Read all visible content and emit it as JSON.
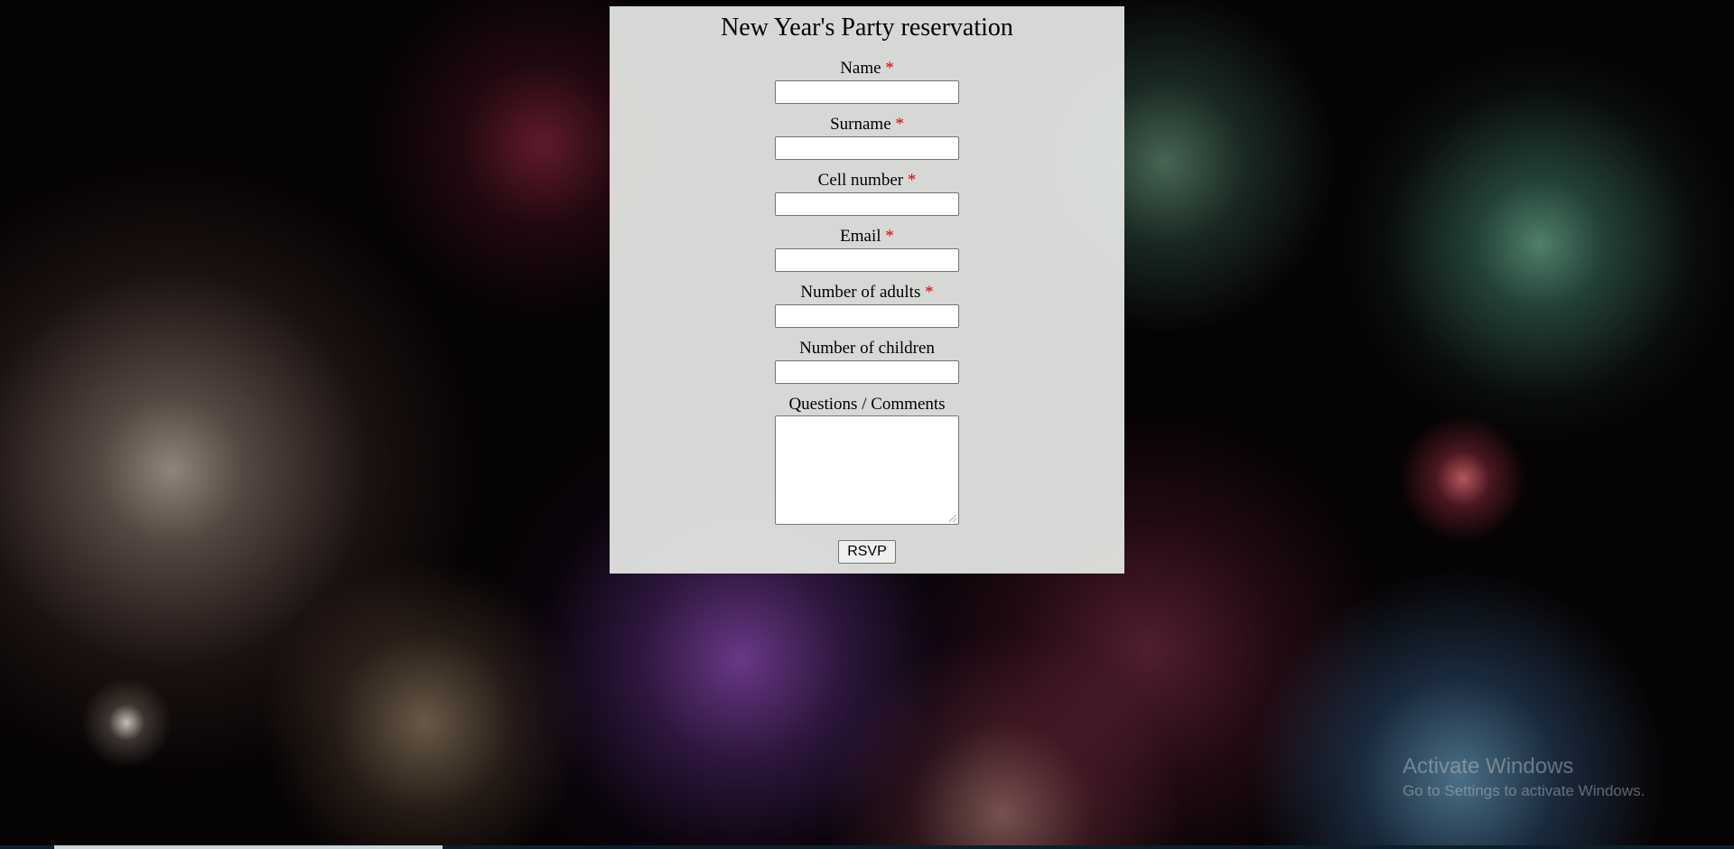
{
  "page": {
    "title": "New Year's Party reservation"
  },
  "form": {
    "required_marker": "*",
    "fields": [
      {
        "label": "Name",
        "required": true,
        "value": ""
      },
      {
        "label": "Surname",
        "required": true,
        "value": ""
      },
      {
        "label": "Cell number",
        "required": true,
        "value": ""
      },
      {
        "label": "Email",
        "required": true,
        "value": ""
      },
      {
        "label": "Number of adults",
        "required": true,
        "value": ""
      },
      {
        "label": "Number of children",
        "required": false,
        "value": ""
      }
    ],
    "comments": {
      "label": "Questions / Comments",
      "value": ""
    },
    "submit_label": "RSVP"
  },
  "watermark": {
    "title": "Activate Windows",
    "subtitle": "Go to Settings to activate Windows."
  },
  "colors": {
    "required_marker": "#e00000",
    "panel_background": "#e6e8e5"
  }
}
